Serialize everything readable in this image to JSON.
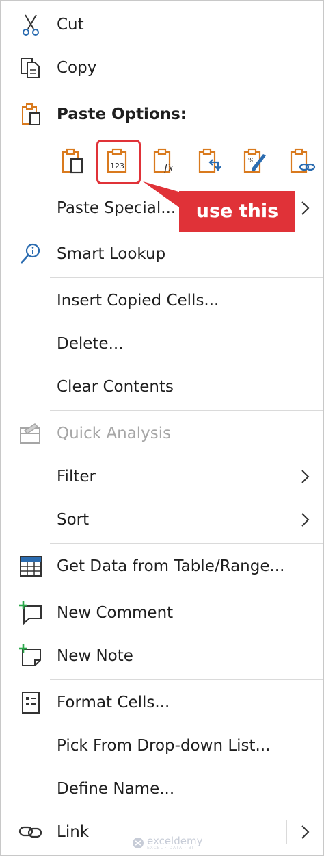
{
  "menu": {
    "cut": {
      "label": "Cut",
      "icon": "scissors-icon"
    },
    "copy": {
      "label": "Copy",
      "icon": "copy-icon"
    },
    "paste_options": {
      "label": "Paste Options:",
      "icon": "clipboard-icon"
    },
    "paste_buttons": [
      {
        "name": "paste-icon"
      },
      {
        "name": "paste-values-icon",
        "text": "123"
      },
      {
        "name": "paste-formulas-icon",
        "text": "fx"
      },
      {
        "name": "paste-transpose-icon"
      },
      {
        "name": "paste-formatting-icon",
        "text": "%"
      },
      {
        "name": "paste-link-icon"
      }
    ],
    "paste_special": {
      "label": "Paste Special..."
    },
    "smart_lookup": {
      "label": "Smart Lookup",
      "icon": "smart-lookup-icon"
    },
    "insert_copied_cells": {
      "label": "Insert Copied Cells..."
    },
    "delete": {
      "label": "Delete..."
    },
    "clear_contents": {
      "label": "Clear Contents"
    },
    "quick_analysis": {
      "label": "Quick Analysis",
      "icon": "quick-analysis-icon",
      "disabled": true
    },
    "filter": {
      "label": "Filter"
    },
    "sort": {
      "label": "Sort"
    },
    "get_data": {
      "label": "Get Data from Table/Range...",
      "icon": "table-icon"
    },
    "new_comment": {
      "label": "New Comment",
      "icon": "new-comment-icon"
    },
    "new_note": {
      "label": "New Note",
      "icon": "new-note-icon"
    },
    "format_cells": {
      "label": "Format Cells...",
      "icon": "format-cells-icon"
    },
    "pick_from_list": {
      "label": "Pick From Drop-down List..."
    },
    "define_name": {
      "label": "Define Name..."
    },
    "link": {
      "label": "Link",
      "icon": "link-icon"
    }
  },
  "callout": {
    "text": "use this",
    "color": "#e03238"
  },
  "watermark": {
    "text": "exceldemy",
    "subtext": "EXCEL · DATA · BI"
  },
  "colors": {
    "accent_orange": "#d97a1e",
    "accent_blue": "#2b6cb0",
    "accent_green": "#2aa84a",
    "highlight_red": "#e03238"
  }
}
